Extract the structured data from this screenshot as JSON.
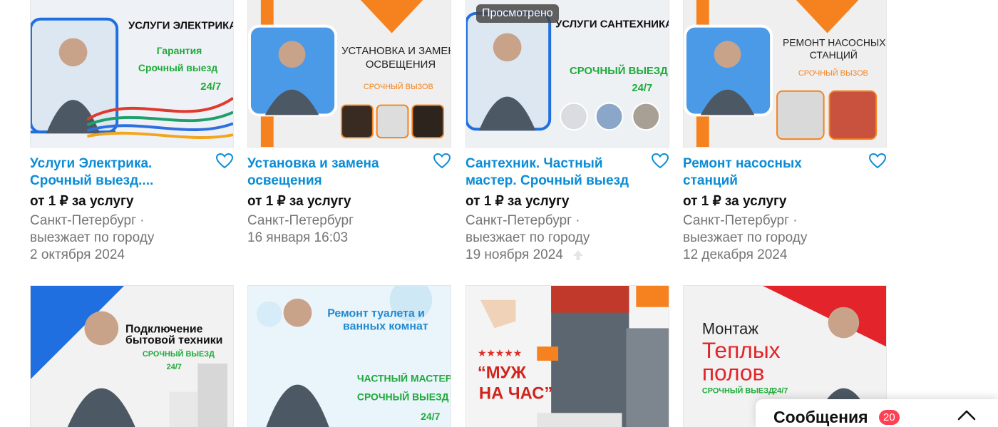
{
  "colors": {
    "link": "#0a8cd6",
    "meta": "#757575",
    "badge": "#ff4053"
  },
  "listings": [
    {
      "title": "Услуги Электрика. Срочный выезд....",
      "price": "от 1 ₽ за услугу",
      "location": "Санкт-Петербург ·",
      "location2": "выезжает по городу",
      "date": "2 октября 2024",
      "viewed": null,
      "img_lines": [
        "УСЛУГИ ЭЛЕКТРИКА",
        "Гарантия",
        "Срочный выезд",
        "24/7"
      ]
    },
    {
      "title": "Установка и замена освещения",
      "price": "от 1 ₽ за услугу",
      "location": "Санкт-Петербург",
      "location2": "16 января 16:03",
      "date": "",
      "viewed": null,
      "img_lines": [
        "УСТАНОВКА И ЗАМЕНА",
        "ОСВЕЩЕНИЯ",
        "СРОЧНЫЙ ВЫЗОВ"
      ]
    },
    {
      "title": "Сантехник. Частный мастер. Срочный выезд",
      "price": "от 1 ₽ за услугу",
      "location": "Санкт-Петербург ·",
      "location2": "выезжает по городу",
      "date": "19 ноября 2024",
      "viewed": "Просмотрено",
      "img_lines": [
        "УСЛУГИ САНТЕХНИКА",
        "СРОЧНЫЙ ВЫЕЗД",
        "24/7"
      ]
    },
    {
      "title": "Ремонт насосных станций",
      "price": "от 1 ₽ за услугу",
      "location": "Санкт-Петербург ·",
      "location2": "выезжает по городу",
      "date": "12 декабря 2024",
      "viewed": null,
      "img_lines": [
        "РЕМОНТ НАСОСНЫХ",
        "СТАНЦИЙ",
        "СРОЧНЫЙ ВЫЗОВ"
      ]
    }
  ],
  "row2_images": [
    {
      "img_lines": [
        "Подключение",
        "бытовой техники",
        "СРОЧНЫЙ ВЫЕЗД",
        "24/7"
      ]
    },
    {
      "img_lines": [
        "Ремонт туалета и",
        "ванных комнат",
        "ЧАСТНЫЙ МАСТЕР",
        "СРОЧНЫЙ ВЫЕЗД",
        "24/7"
      ]
    },
    {
      "img_lines": [
        "“МУЖ",
        "НА ЧАС”"
      ]
    },
    {
      "img_lines": [
        "Монтаж",
        "Теплых",
        "полов",
        "СРОЧНЫЙ ВЫЕЗД",
        "24/7"
      ]
    }
  ],
  "messages": {
    "label": "Сообщения",
    "count": "20"
  }
}
